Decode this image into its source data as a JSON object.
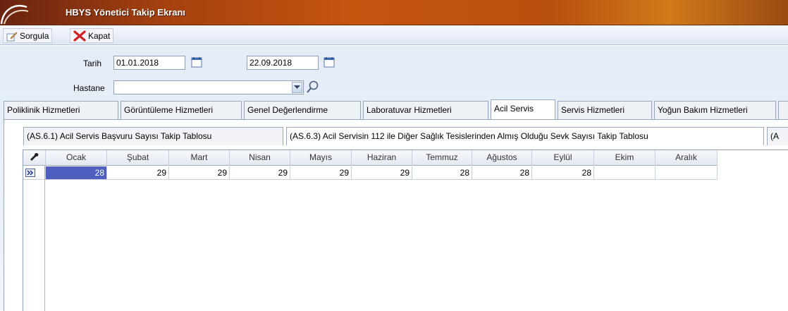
{
  "window": {
    "title": "HBYS Yönetici Takip Ekranı"
  },
  "toolbar": {
    "query_label": "Sorgula",
    "close_label": "Kapat"
  },
  "form": {
    "date_label": "Tarih",
    "date_from": "01.01.2018",
    "date_to": "22.09.2018",
    "hospital_label": "Hastane",
    "hospital_value": ""
  },
  "tabs": [
    {
      "label": "Poliklinik Hizmetleri"
    },
    {
      "label": "Görüntüleme Hizmetleri"
    },
    {
      "label": "Genel Değerlendirme"
    },
    {
      "label": "Laboratuvar Hizmetleri"
    },
    {
      "label": "Acil Servis",
      "active": true
    },
    {
      "label": "Servis Hizmetleri"
    },
    {
      "label": "Yoğun Bakım Hizmetleri"
    }
  ],
  "subtabs": [
    {
      "label": "(AS.6.1) Acil Servis Başvuru Sayısı Takip Tablosu"
    },
    {
      "label": "(AS.6.3) Acil Servisin 112 ile Diğer Sağlık Tesislerinden Almış Olduğu Sevk Sayısı Takip Tablosu"
    },
    {
      "label": "(A"
    }
  ],
  "grid": {
    "columns": [
      "Ocak",
      "Şubat",
      "Mart",
      "Nisan",
      "Mayıs",
      "Haziran",
      "Temmuz",
      "Ağustos",
      "Eylül",
      "Ekim",
      "Aralık"
    ],
    "row": [
      "28",
      "29",
      "29",
      "29",
      "29",
      "29",
      "28",
      "28",
      "28",
      "",
      ""
    ]
  },
  "colors": {
    "accent": "#c5540f",
    "selection": "#4e5fbf"
  }
}
